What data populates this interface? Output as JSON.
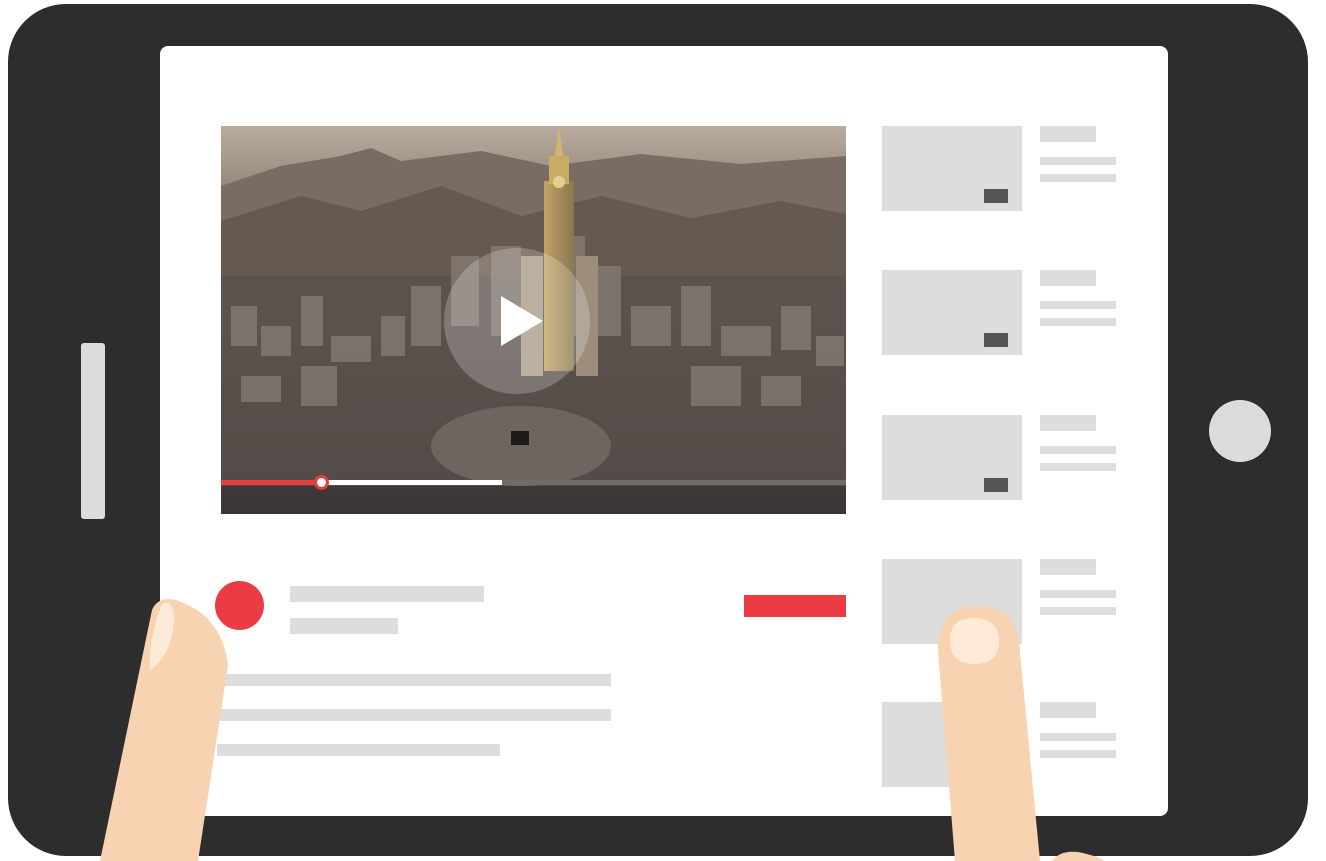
{
  "device": {
    "frame_color": "#2d2d2d",
    "screen_color": "#ffffff",
    "button_color": "#dcdcdc"
  },
  "video_player": {
    "scene": "aerial-city-with-clock-tower",
    "play_icon": "play-icon",
    "progress_played": 0.16,
    "progress_buffered": 0.45,
    "accent_color": "#ec3c43"
  },
  "channel": {
    "avatar_icon": "avatar-circle",
    "accent_color": "#ec3c43"
  },
  "suggested_videos": [
    {
      "has_duration_badge": true
    },
    {
      "has_duration_badge": true
    },
    {
      "has_duration_badge": true
    },
    {
      "has_duration_badge": false
    },
    {
      "has_duration_badge": false
    }
  ],
  "hands": {
    "skin_color": "#f8d3b1",
    "nail_color": "#fdebd8"
  }
}
